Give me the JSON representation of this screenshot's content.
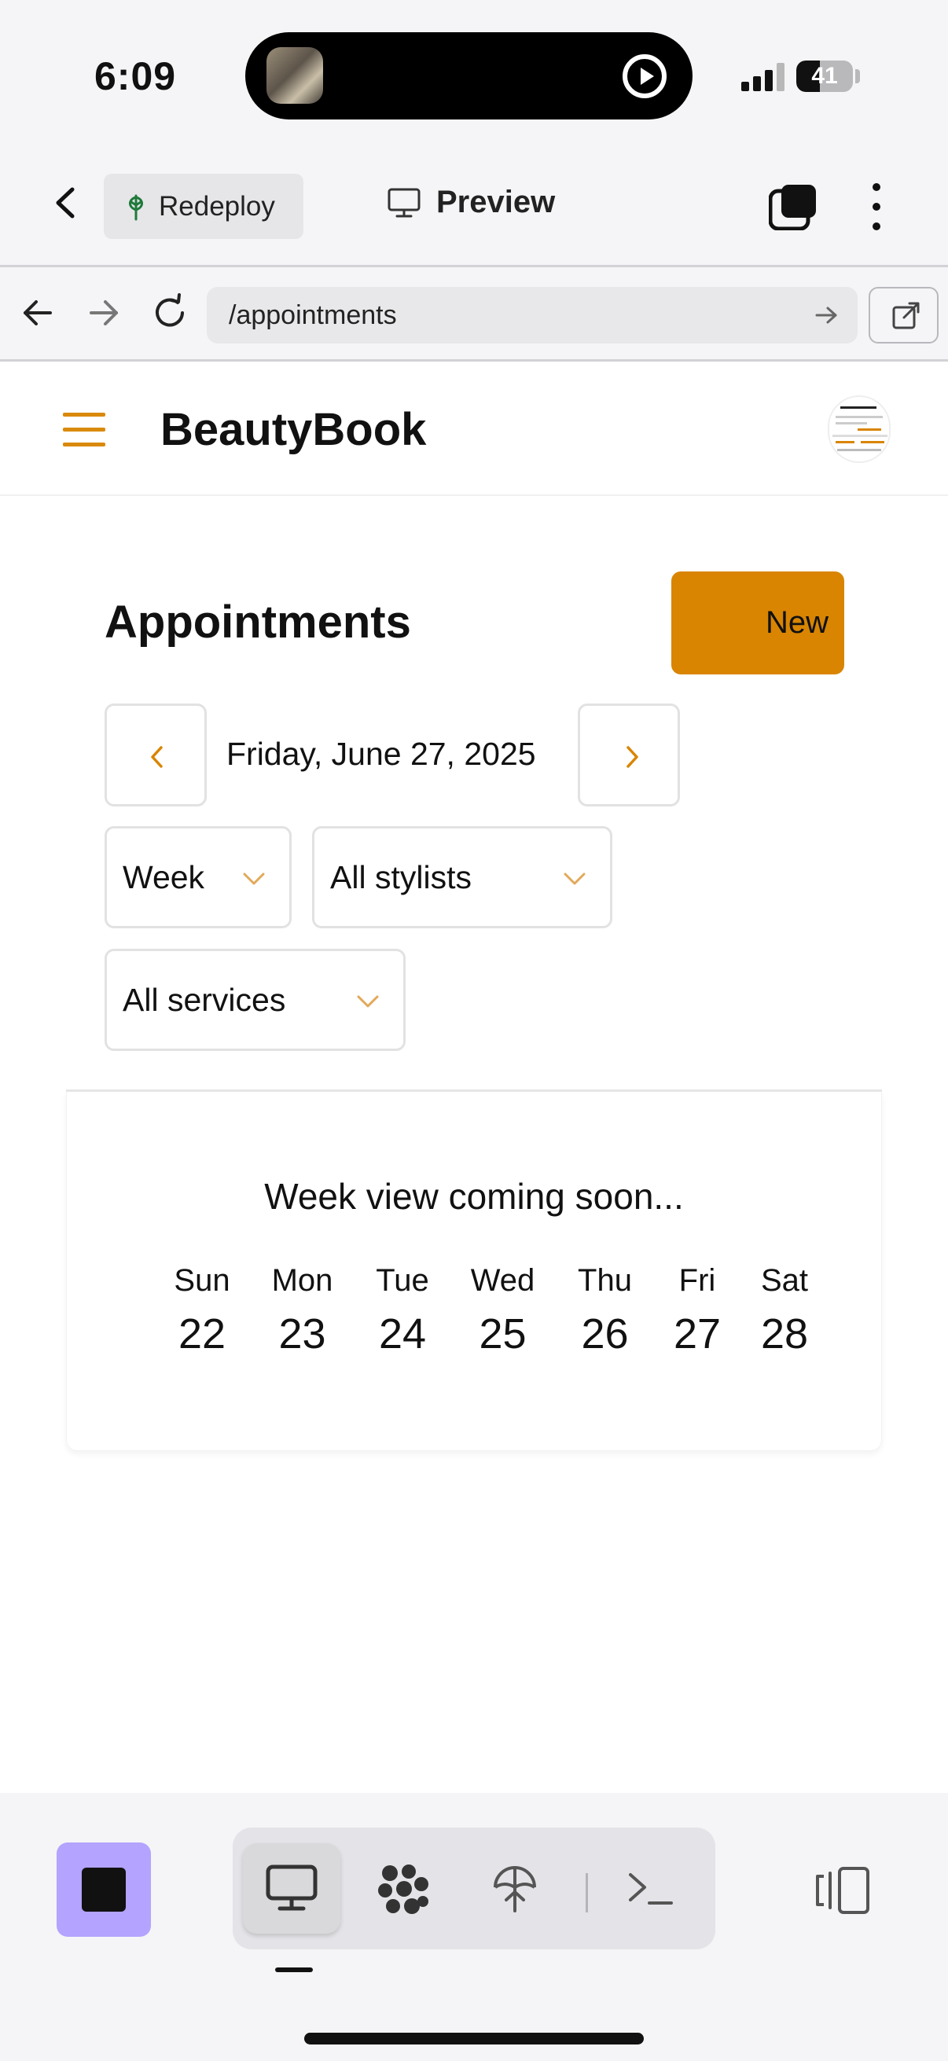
{
  "status_bar": {
    "time": "6:09",
    "battery": "41"
  },
  "app_toolbar": {
    "redeploy_label": "Redeploy",
    "preview_label": "Preview"
  },
  "url_bar": {
    "url": "/appointments"
  },
  "app": {
    "brand": "BeautyBook"
  },
  "page": {
    "title": "Appointments",
    "new_button": "New",
    "current_date": "Friday, June 27, 2025",
    "view_select": "Week",
    "stylist_select": "All stylists",
    "service_select": "All services"
  },
  "week_view": {
    "message": "Week view coming soon...",
    "days": [
      {
        "name": "Sun",
        "date": "22"
      },
      {
        "name": "Mon",
        "date": "23"
      },
      {
        "name": "Tue",
        "date": "24"
      },
      {
        "name": "Wed",
        "date": "25"
      },
      {
        "name": "Thu",
        "date": "26"
      },
      {
        "name": "Fri",
        "date": "27"
      },
      {
        "name": "Sat",
        "date": "28"
      }
    ]
  },
  "colors": {
    "accent": "#d98502",
    "stop_button": "#b4a3ff"
  },
  "icons": {
    "back": "chevron-left-icon",
    "redeploy": "tree-icon",
    "preview": "monitor-icon",
    "tabs": "tabs-icon",
    "more": "kebab-icon",
    "nav_back": "arrow-left-icon",
    "nav_forward": "arrow-right-icon",
    "reload": "reload-icon",
    "url_go": "arrow-right-icon",
    "external": "external-link-icon",
    "menu": "hamburger-icon",
    "prev_date": "chevron-left-icon",
    "next_date": "chevron-right-icon",
    "dropdown": "chevron-down-icon",
    "stop": "stop-icon",
    "desktop": "monitor-icon",
    "workspace": "dots-grid-icon",
    "deploy": "deploy-icon",
    "terminal": "terminal-icon",
    "side_panel": "side-panel-icon"
  }
}
